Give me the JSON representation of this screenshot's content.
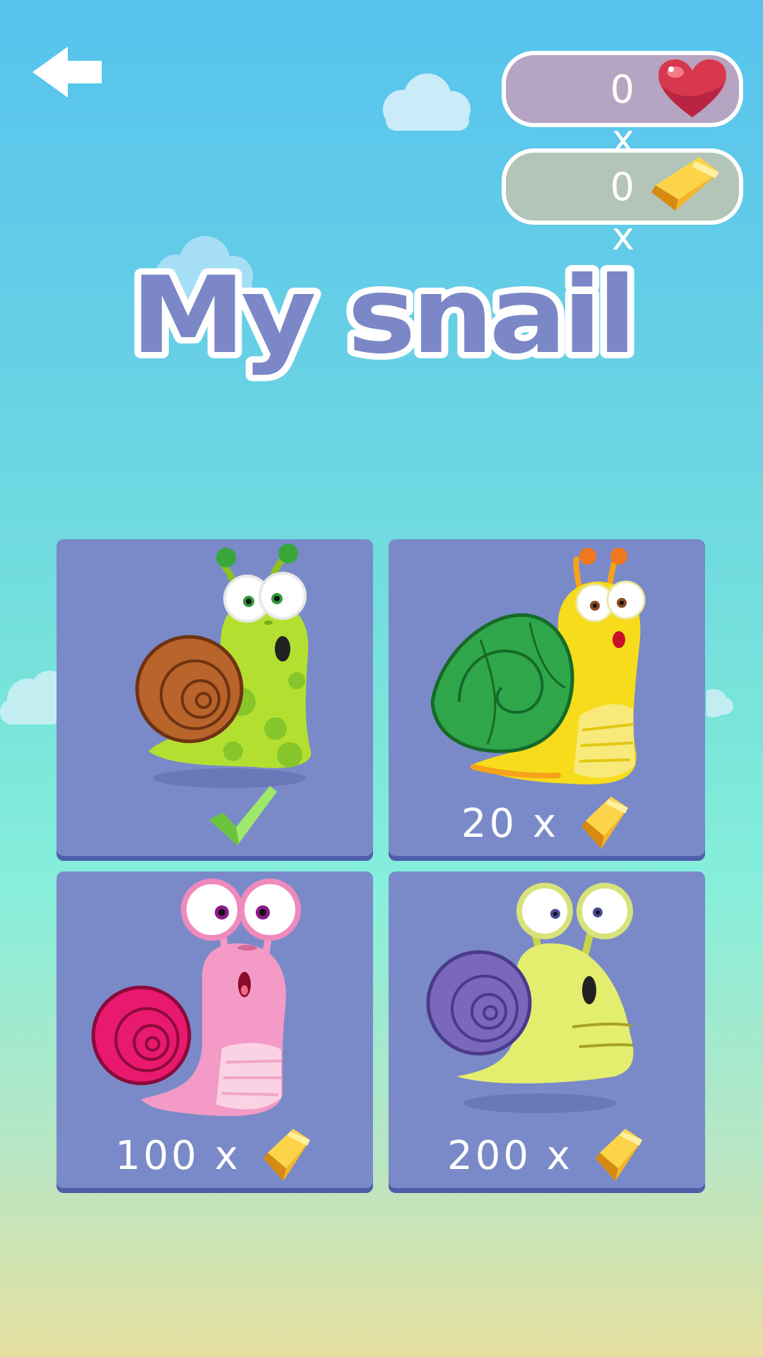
{
  "header": {
    "back_icon": "arrow-left-icon",
    "hearts": {
      "count": "0",
      "separator": "x",
      "icon": "heart-icon"
    },
    "gems": {
      "count": "0",
      "separator": "x",
      "icon": "gem-icon"
    }
  },
  "title": "My snail",
  "snails": [
    {
      "id": "green",
      "status": "selected",
      "status_icon": "checkmark-icon",
      "colors": {
        "body": "#b3e030",
        "shell": "#b8642a"
      }
    },
    {
      "id": "yellow",
      "status": "locked",
      "price": "20",
      "separator": "x",
      "currency_icon": "gem-icon",
      "colors": {
        "body": "#f6dc1a",
        "shell": "#2fa64a"
      }
    },
    {
      "id": "pink",
      "status": "locked",
      "price": "100",
      "separator": "x",
      "currency_icon": "gem-icon",
      "colors": {
        "body": "#f39ac6",
        "shell": "#e8196f"
      }
    },
    {
      "id": "lime",
      "status": "locked",
      "price": "200",
      "separator": "x",
      "currency_icon": "gem-icon",
      "colors": {
        "body": "#e4ee6e",
        "shell": "#7a68bc"
      }
    }
  ],
  "colors": {
    "card": "#7a8ac8",
    "title_fill": "#7b87c6",
    "title_outline": "#ffffff"
  }
}
